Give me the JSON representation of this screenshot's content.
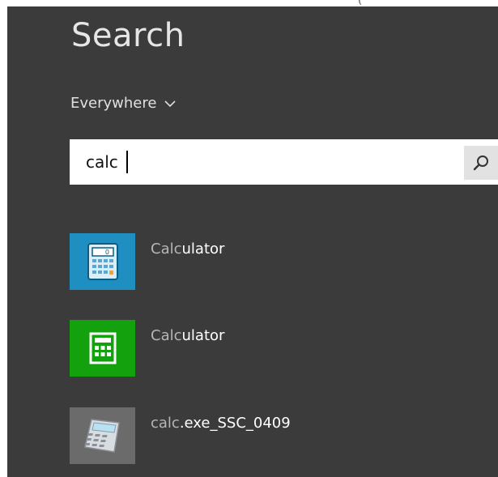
{
  "top_fragment": "(",
  "title": "Search",
  "scope": {
    "label": "Everywhere",
    "icon": "chevron-down-icon"
  },
  "search": {
    "value": "calc",
    "placeholder": "",
    "button_icon": "magnifier-icon"
  },
  "results": [
    {
      "match": "Calc",
      "rest": "ulator",
      "icon": "calculator-blue-icon",
      "tile_color": "#1f8ec1"
    },
    {
      "match": "Calc",
      "rest": "ulator",
      "icon": "calculator-green-icon",
      "tile_color": "#13a10e"
    },
    {
      "match": "calc",
      "rest": ".exe_SSC_0409",
      "icon": "calculator-classic-icon",
      "tile_color": "#6b6b6b"
    }
  ],
  "colors": {
    "pane": "#3b3b3b",
    "text": "#ffffff",
    "dim_text": "#b6b6b6"
  }
}
